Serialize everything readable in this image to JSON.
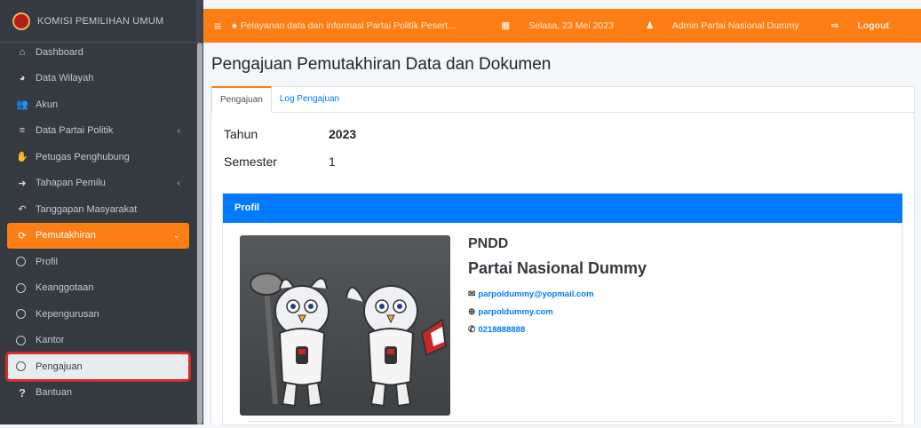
{
  "app": {
    "brand": "KOMISI PEMILIHAN UMUM",
    "logo_initial": "KPU"
  },
  "sidebar": {
    "items": [
      {
        "icon": "home-icon",
        "glyph": "⌂",
        "label": "Dashboard"
      },
      {
        "icon": "globe-icon",
        "glyph": "◕",
        "label": "Data Wilayah"
      },
      {
        "icon": "users-icon",
        "glyph": "👥",
        "label": "Akun"
      },
      {
        "icon": "database-icon",
        "glyph": "≡",
        "label": "Data Partai Politik",
        "caret": "‹"
      },
      {
        "icon": "handshake-icon",
        "glyph": "✋",
        "label": "Petugas Penghubung"
      },
      {
        "icon": "sign-in-icon",
        "glyph": "➜",
        "label": "Tahapan Pemilu",
        "caret": "‹"
      },
      {
        "icon": "reply-icon",
        "glyph": "↶",
        "label": "Tanggapan Masyarakat"
      },
      {
        "icon": "sync-icon",
        "glyph": "⟳",
        "label": "Pemutakhiran",
        "caret": "⌄"
      }
    ],
    "subitems": [
      "Profil",
      "Keanggotaan",
      "Kepengurusan",
      "Kantor",
      "Pengajuan"
    ],
    "help": {
      "glyph": "?",
      "label": "Bantuan"
    }
  },
  "topbar": {
    "menu_glyph": "≡",
    "announcement": "Pelayanan data dan informasi Partai Politik Pesert...",
    "date": "Selasa, 23 Mei 2023",
    "user": "Admin Partai Nasional Dummy",
    "logout": "Logout"
  },
  "page": {
    "title": "Pengajuan Pemutakhiran Data dan Dokumen",
    "tabs": [
      "Pengajuan",
      "Log Pengajuan"
    ],
    "fields": {
      "tahun_label": "Tahun",
      "tahun": "2023",
      "semester_label": "Semester",
      "semester": "1"
    }
  },
  "profil": {
    "header": "Profil",
    "abbr": "PNDD",
    "name": "Partai Nasional Dummy",
    "email": "parpoldummy@yopmail.com",
    "website": "parpoldummy.com",
    "phone": "0218888888"
  },
  "colors": {
    "accent": "#fd7e14",
    "primary": "#007bff",
    "sidebar": "#343a40"
  }
}
